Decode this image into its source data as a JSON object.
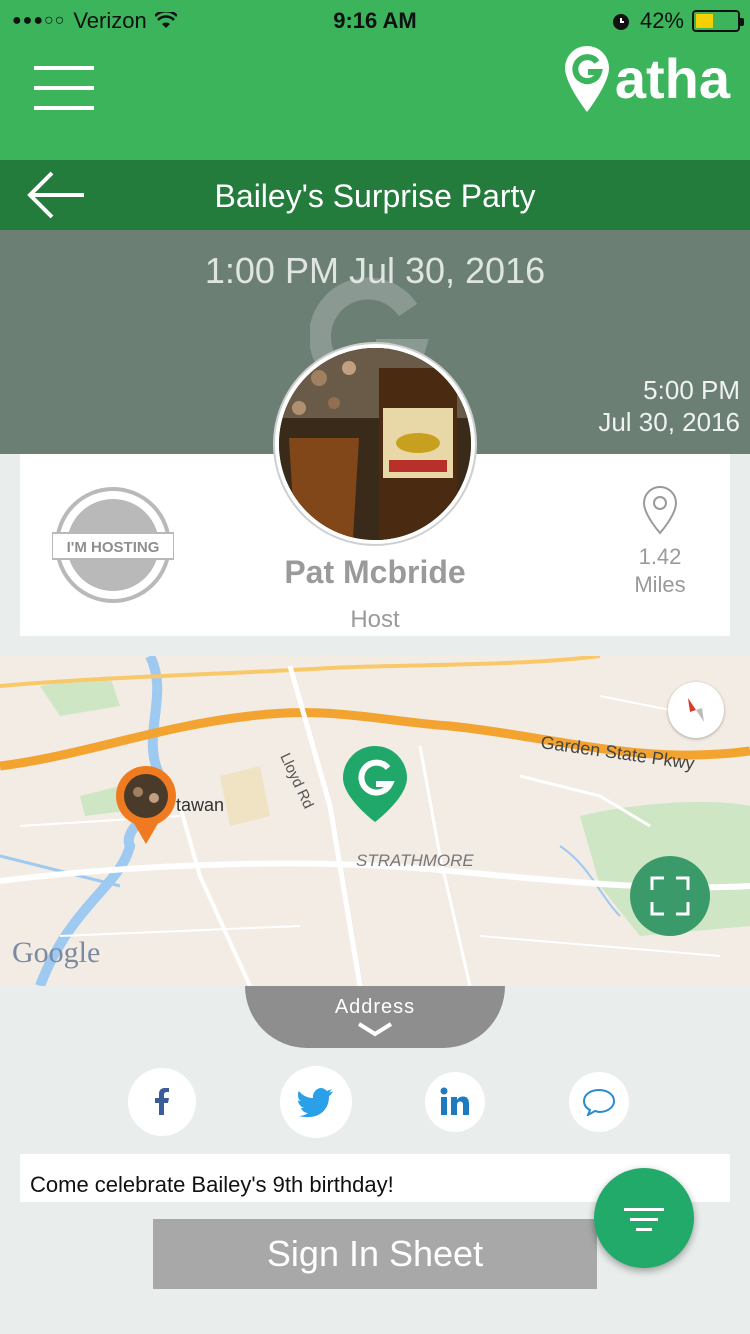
{
  "status_bar": {
    "carrier": "Verizon",
    "time": "9:16 AM",
    "battery": "42%",
    "battery_level": 0.42
  },
  "app": {
    "brand": "Gatha"
  },
  "event": {
    "title": "Bailey's Surprise Party",
    "start": "1:00 PM Jul 30, 2016",
    "end_time": "5:00 PM",
    "end_date": "Jul 30, 2016",
    "badge_text": "I'M HOSTING",
    "host_name": "Pat Mcbride",
    "host_role": "Host",
    "distance_value": "1.42",
    "distance_unit": "Miles",
    "description": "Come celebrate Bailey's 9th birthday!"
  },
  "map": {
    "labels": {
      "highway": "Garden State Pkwy",
      "road": "Lloyd Rd",
      "area": "STRATHMORE",
      "town": "tawan",
      "attribution": "Google"
    }
  },
  "address_tab": {
    "label": "Address"
  },
  "social": [
    "facebook-icon",
    "twitter-icon",
    "linkedin-icon",
    "message-icon"
  ],
  "actions": {
    "sign_in_sheet": "Sign In Sheet"
  },
  "colors": {
    "appbar": "#3bb45c",
    "titlebar": "#237b3c",
    "hero": "#6b7f75",
    "fab": "#22aa6a",
    "map_fullscreen": "#3b9a6a"
  }
}
